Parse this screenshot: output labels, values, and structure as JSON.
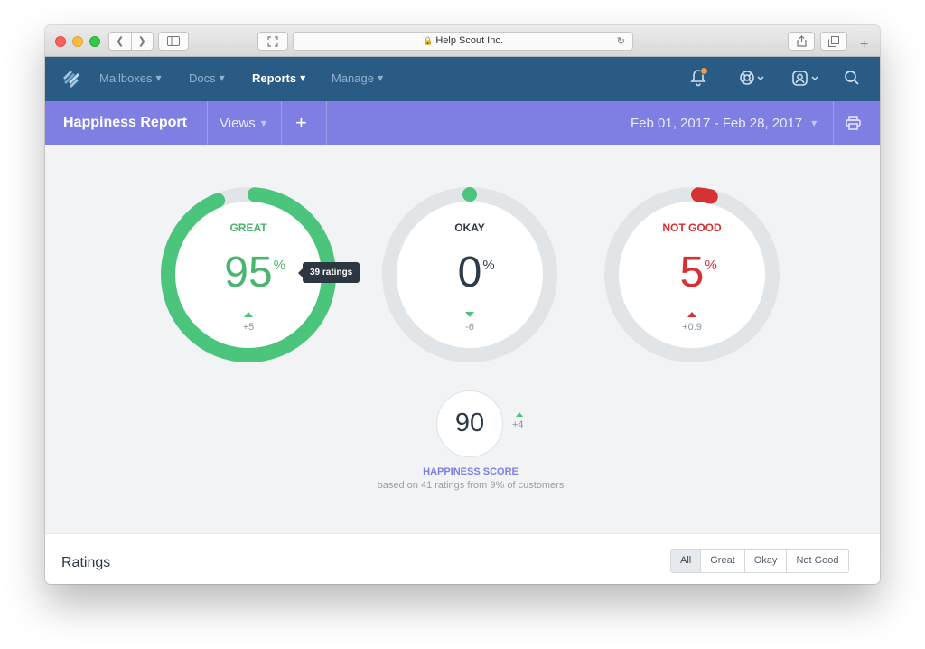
{
  "browser": {
    "address": "Help Scout Inc.",
    "icons": [
      "back-icon",
      "forward-icon",
      "sidebar-icon",
      "fullscreen-icon",
      "lock-icon",
      "reload-icon",
      "share-icon",
      "tabs-icon",
      "plus-icon"
    ]
  },
  "nav": {
    "items": [
      {
        "label": "Mailboxes",
        "active": false
      },
      {
        "label": "Docs",
        "active": false
      },
      {
        "label": "Reports",
        "active": true
      },
      {
        "label": "Manage",
        "active": false
      }
    ],
    "icons": [
      "helpscout-logo",
      "bell-icon",
      "help-icon",
      "profile-icon",
      "search-icon"
    ]
  },
  "report": {
    "title": "Happiness Report",
    "views_label": "Views",
    "add_label": "+",
    "date_range": "Feb 01, 2017 - Feb 28, 2017"
  },
  "gauges": [
    {
      "label": "GREAT",
      "value": "95",
      "unit": "%",
      "delta": "+5",
      "trend": "up",
      "fraction": 0.95,
      "color": "#4bc57c",
      "text_color": "#4bb56f"
    },
    {
      "label": "OKAY",
      "value": "0",
      "unit": "%",
      "delta": "-6",
      "trend": "down",
      "fraction": 0.0,
      "color": "#4bc57c",
      "text_color": "#2e3a46"
    },
    {
      "label": "NOT GOOD",
      "value": "5",
      "unit": "%",
      "delta": "+0.9",
      "trend": "up",
      "fraction": 0.05,
      "color": "#d63133",
      "text_color": "#d63133"
    }
  ],
  "tooltip": "39 ratings",
  "score": {
    "value": "90",
    "delta": "+4",
    "label": "HAPPINESS SCORE",
    "subtitle": "based on 41 ratings from 9% of customers"
  },
  "ratings": {
    "title": "Ratings",
    "filters": [
      "All",
      "Great",
      "Okay",
      "Not Good"
    ],
    "selected": "All"
  },
  "colors": {
    "nav_bg": "#2a5b85",
    "header_bg": "#7f7fe3",
    "great": "#4bc57c",
    "not_good": "#d63133",
    "track": "#e1e5e8"
  }
}
